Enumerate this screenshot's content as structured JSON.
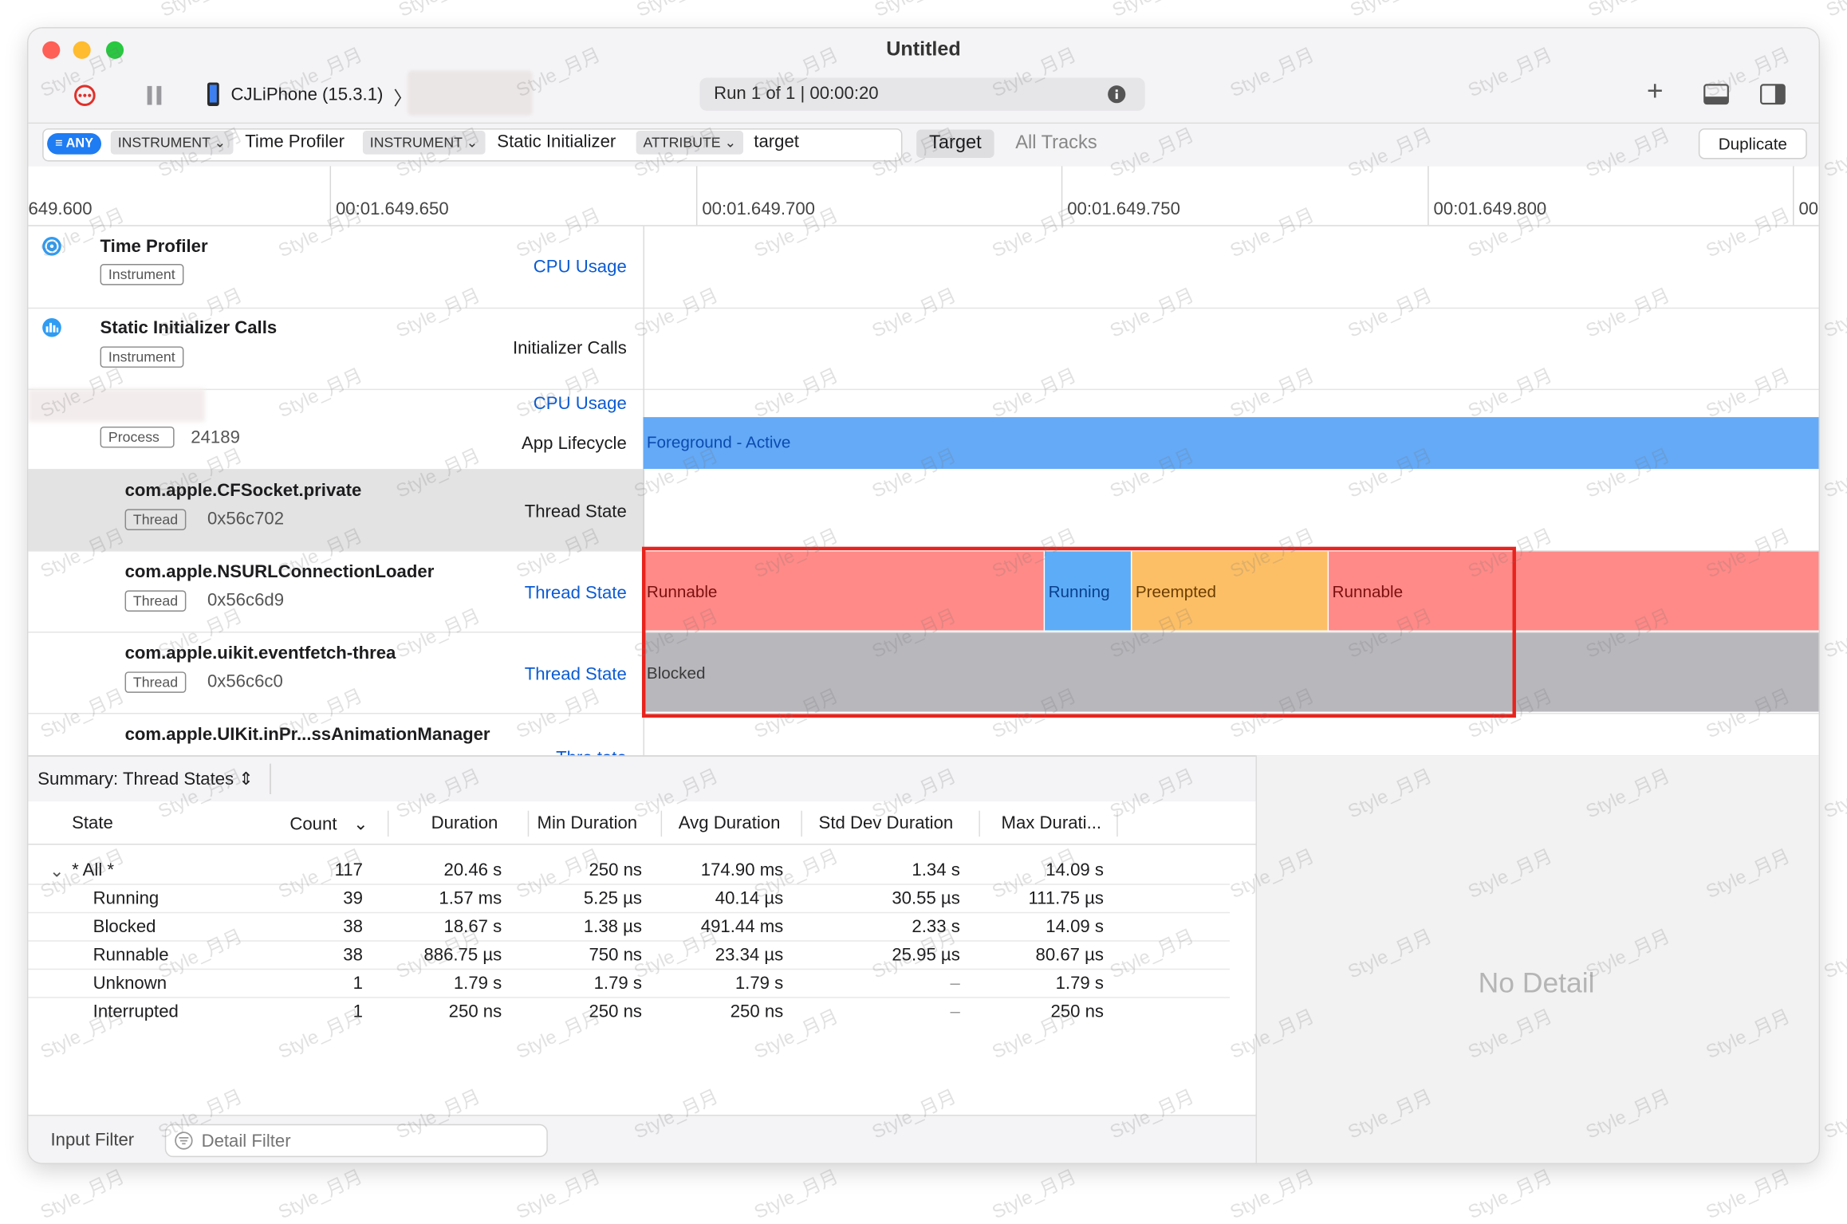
{
  "window": {
    "title": "Untitled"
  },
  "toolbar": {
    "device": "CJLiPhone (15.3.1)",
    "device_chevron": "〉",
    "run_status": "Run 1 of 1  |  00:00:20",
    "add_icon": "+"
  },
  "filter": {
    "any_label": "ANY",
    "tokens": [
      {
        "kind": "INSTRUMENT",
        "value": "Time Profiler"
      },
      {
        "kind": "INSTRUMENT",
        "value": "Static Initializer"
      },
      {
        "kind": "ATTRIBUTE",
        "value": "target"
      }
    ],
    "target_btn": "Target",
    "all_tracks_btn": "All Tracks",
    "duplicate_btn": "Duplicate"
  },
  "ruler": {
    "ticks": [
      "649.600",
      "00:01.649.650",
      "00:01.649.700",
      "00:01.649.750",
      "00:01.649.800",
      "00"
    ]
  },
  "tracks": [
    {
      "title": "Time Profiler",
      "tag": "Instrument",
      "track": "CPU Usage"
    },
    {
      "title": "Static Initializer Calls",
      "tag": "Instrument",
      "track": "Initializer Calls"
    },
    {
      "tag": "Process",
      "pid": "24189",
      "track_cpu": "CPU Usage",
      "track_life": "App Lifecycle",
      "lifecycle_state": "Foreground - Active"
    },
    {
      "title": "com.apple.CFSocket.private",
      "tag": "Thread",
      "addr": "0x56c702",
      "track": "Thread State"
    },
    {
      "title": "com.apple.NSURLConnectionLoader",
      "tag": "Thread",
      "addr": "0x56c6d9",
      "track": "Thread State",
      "segments": [
        "Runnable",
        "Running",
        "Preempted",
        "Runnable"
      ]
    },
    {
      "title": "com.apple.uikit.eventfetch-threa",
      "tag": "Thread",
      "addr": "0x56c6c0",
      "track": "Thread State",
      "segments": [
        "Blocked"
      ]
    },
    {
      "title": "com.apple.UIKit.inPr...ssAnimationManager",
      "track": "Thre   tate"
    }
  ],
  "summary": {
    "title": "Summary: Thread States",
    "columns": [
      "State",
      "Count",
      "Duration",
      "Min Duration",
      "Avg Duration",
      "Std Dev Duration",
      "Max Durati..."
    ],
    "rows": [
      {
        "state": "* All *",
        "count": "117",
        "duration": "20.46 s",
        "min": "250 ns",
        "avg": "174.90 ms",
        "std": "1.34 s",
        "max": "14.09 s"
      },
      {
        "state": "Running",
        "count": "39",
        "duration": "1.57 ms",
        "min": "5.25 µs",
        "avg": "40.14 µs",
        "std": "30.55 µs",
        "max": "111.75 µs"
      },
      {
        "state": "Blocked",
        "count": "38",
        "duration": "18.67 s",
        "min": "1.38 µs",
        "avg": "491.44 ms",
        "std": "2.33 s",
        "max": "14.09 s"
      },
      {
        "state": "Runnable",
        "count": "38",
        "duration": "886.75 µs",
        "min": "750 ns",
        "avg": "23.34 µs",
        "std": "25.95 µs",
        "max": "80.67 µs"
      },
      {
        "state": "Unknown",
        "count": "1",
        "duration": "1.79 s",
        "min": "1.79 s",
        "avg": "1.79 s",
        "std": "–",
        "max": "1.79 s"
      },
      {
        "state": "Interrupted",
        "count": "1",
        "duration": "250 ns",
        "min": "250 ns",
        "avg": "250 ns",
        "std": "–",
        "max": "250 ns"
      }
    ]
  },
  "detail": {
    "empty_text": "No Detail"
  },
  "footer": {
    "input_filter_label": "Input Filter",
    "detail_filter_placeholder": "Detail Filter"
  },
  "watermark": "Style_月月",
  "colors": {
    "runnable": "#ff8a87",
    "running": "#5dacf7",
    "preempted": "#fdbf66",
    "blocked": "#b8b7bc",
    "lifecycle": "#64aaf7",
    "highlight": "#e8231d"
  }
}
